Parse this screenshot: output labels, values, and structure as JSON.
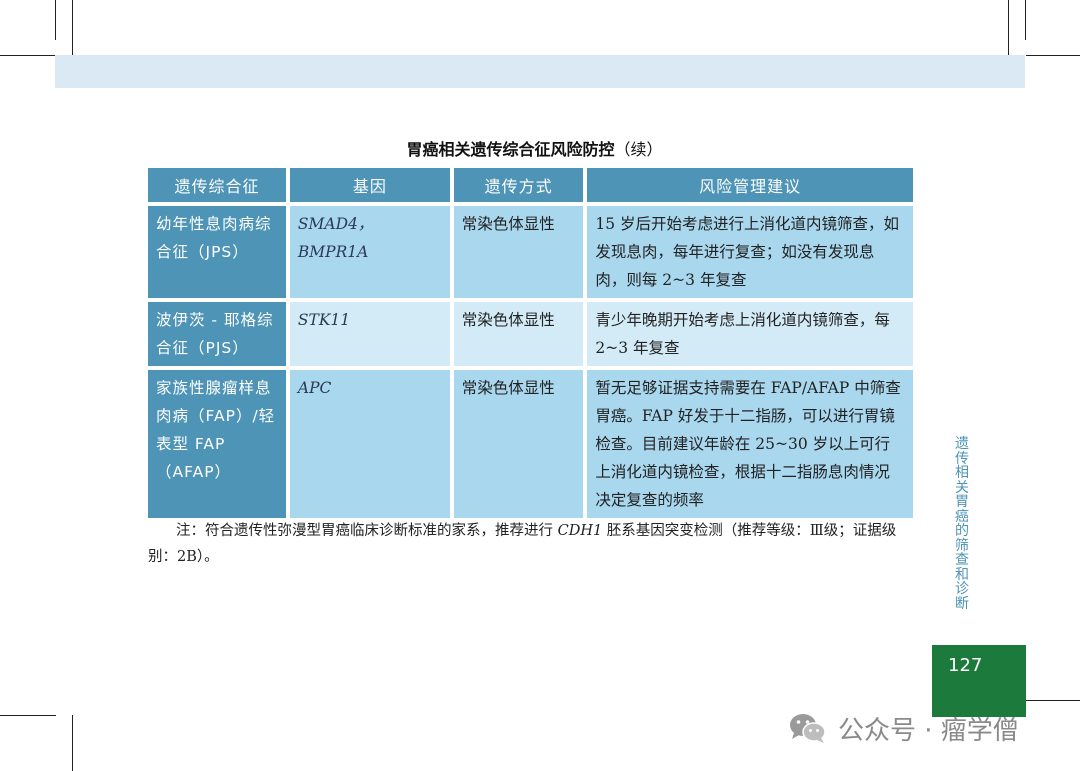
{
  "table": {
    "title": "胃癌相关遗传综合征风险防控",
    "title_suffix": "（续）",
    "headers": [
      "遗传综合征",
      "基因",
      "遗传方式",
      "风险管理建议"
    ],
    "rows": [
      {
        "syndrome": "幼年性息肉病综合征（JPS）",
        "gene": "SMAD4，BMPR1A",
        "mode": "常染色体显性",
        "advice": "15 岁后开始考虑进行上消化道内镜筛查，如发现息肉，每年进行复查；如没有发现息肉，则每 2~3 年复查"
      },
      {
        "syndrome": "波伊茨 - 耶格综合征（PJS）",
        "gene": "STK11",
        "mode": "常染色体显性",
        "advice": "青少年晚期开始考虑上消化道内镜筛查，每 2~3 年复查"
      },
      {
        "syndrome": "家族性腺瘤样息肉病（FAP）/轻表型 FAP（AFAP）",
        "gene": "APC",
        "mode": "常染色体显性",
        "advice": "暂无足够证据支持需要在 FAP/AFAP 中筛查胃癌。FAP 好发于十二指肠，可以进行胃镜检查。目前建议年龄在 25~30 岁以上可行上消化道内镜检查，根据十二指肠息肉情况决定复查的频率"
      }
    ]
  },
  "note": {
    "prefix": "注：符合遗传性弥漫型胃癌临床诊断标准的家系，推荐进行 ",
    "gene": "CDH1",
    "suffix": " 胚系基因突变检测（推荐等级：Ⅲ级；证据级别：2B）。"
  },
  "side_title": "遗传相关胃癌的筛查和诊断",
  "page_number": "127",
  "watermark": "公众号 · 瘤学僧",
  "colors": {
    "header_band": "#dbe9f5",
    "table_dark": "#4d94b6",
    "table_light": "#a8d7ee",
    "table_lighter": "#d3ebf7",
    "page_box": "#1b7a3c"
  },
  "icons": [
    "wechat-icon"
  ]
}
